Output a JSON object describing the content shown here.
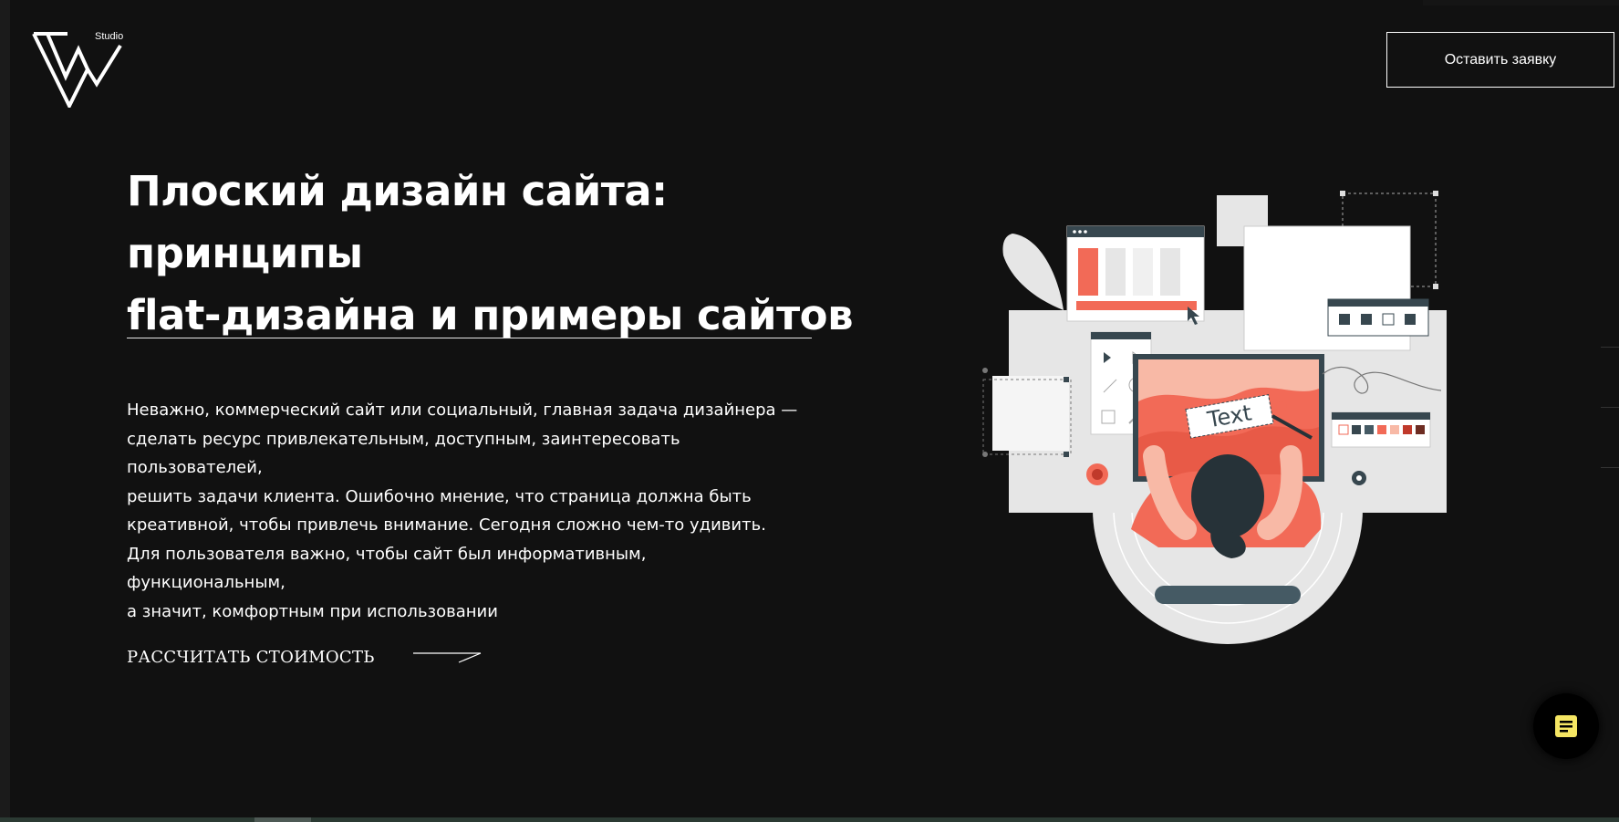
{
  "header": {
    "logo_text": "Studio",
    "cta_label": "Оставить заявку"
  },
  "hero": {
    "title_line1": "Плоский дизайн сайта: принципы",
    "title_line2": "flat-дизайна и примеры сайтов",
    "description_lines": [
      "Неважно, коммерческий сайт или социальный, главная задача дизайнера —",
      "сделать ресурс привлекательным, доступным, заинтересовать пользователей,",
      "решить задачи клиента. Ошибочно мнение, что страница должна быть",
      "креативной, чтобы привлечь внимание. Сегодня сложно чем-то удивить.",
      "Для пользователя важно, чтобы сайт был информативным, функциональным,",
      "а значит, комфортным при использовании"
    ],
    "calc_label": "РАССЧИТАТЬ СТОИМОСТЬ"
  },
  "illustration": {
    "text_label": "Text",
    "colors": {
      "accent": "#f26a57",
      "accent_light": "#f8b9a6",
      "dark": "#37474f",
      "light_gray": "#e6e6e6",
      "card": "#f5f5f5"
    }
  },
  "chat": {
    "icon": "chat-note-icon",
    "icon_color": "#f5e663"
  }
}
